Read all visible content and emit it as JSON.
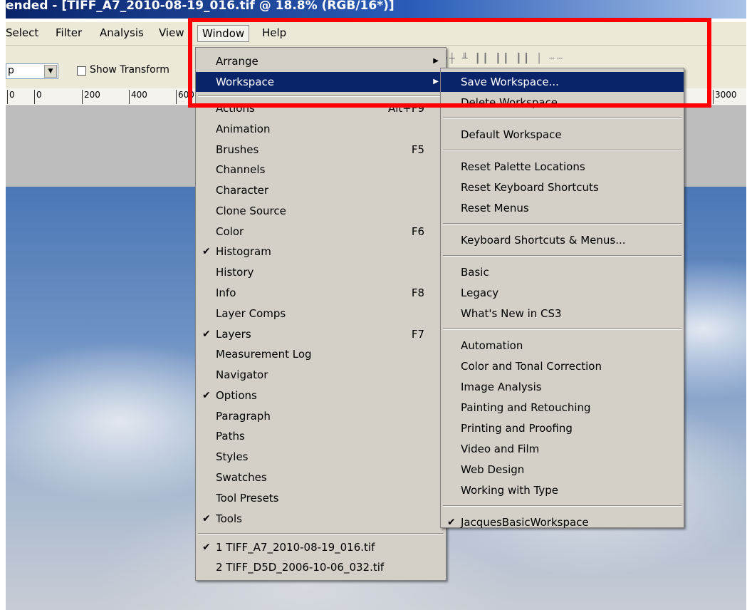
{
  "app": {
    "title": "ended - [TIFF_A7_2010-08-19_016.tif @ 18.8% (RGB/16*)]"
  },
  "menubar": {
    "items": [
      "Select",
      "Filter",
      "Analysis",
      "View",
      "Window",
      "Help"
    ],
    "active": "Window"
  },
  "options_bar": {
    "combo_value": "p",
    "show_transform_label": "Show Transform"
  },
  "ruler": {
    "ticks": [
      "0",
      "0",
      "200",
      "400",
      "600",
      "3000"
    ]
  },
  "window_menu": {
    "top_items": [
      {
        "label": "Arrange",
        "submenu": true
      },
      {
        "label": "Workspace",
        "submenu": true,
        "highlighted": true
      }
    ],
    "panel_items": [
      {
        "label": "Actions",
        "shortcut": "Alt+F9",
        "checked": false
      },
      {
        "label": "Animation",
        "shortcut": "",
        "checked": false
      },
      {
        "label": "Brushes",
        "shortcut": "F5",
        "checked": false
      },
      {
        "label": "Channels",
        "shortcut": "",
        "checked": false
      },
      {
        "label": "Character",
        "shortcut": "",
        "checked": false
      },
      {
        "label": "Clone Source",
        "shortcut": "",
        "checked": false
      },
      {
        "label": "Color",
        "shortcut": "F6",
        "checked": false
      },
      {
        "label": "Histogram",
        "shortcut": "",
        "checked": true
      },
      {
        "label": "History",
        "shortcut": "",
        "checked": false
      },
      {
        "label": "Info",
        "shortcut": "F8",
        "checked": false
      },
      {
        "label": "Layer Comps",
        "shortcut": "",
        "checked": false
      },
      {
        "label": "Layers",
        "shortcut": "F7",
        "checked": true
      },
      {
        "label": "Measurement Log",
        "shortcut": "",
        "checked": false
      },
      {
        "label": "Navigator",
        "shortcut": "",
        "checked": false
      },
      {
        "label": "Options",
        "shortcut": "",
        "checked": true
      },
      {
        "label": "Paragraph",
        "shortcut": "",
        "checked": false
      },
      {
        "label": "Paths",
        "shortcut": "",
        "checked": false
      },
      {
        "label": "Styles",
        "shortcut": "",
        "checked": false
      },
      {
        "label": "Swatches",
        "shortcut": "",
        "checked": false
      },
      {
        "label": "Tool Presets",
        "shortcut": "",
        "checked": false
      },
      {
        "label": "Tools",
        "shortcut": "",
        "checked": true
      }
    ],
    "documents": [
      {
        "label": "1 TIFF_A7_2010-08-19_016.tif",
        "checked": true
      },
      {
        "label": "2 TIFF_D5D_2006-10-06_032.tif",
        "checked": false
      }
    ]
  },
  "workspace_menu": {
    "groups": [
      [
        {
          "label": "Save Workspace...",
          "highlighted": true
        },
        {
          "label": "Delete Workspace..."
        }
      ],
      [
        {
          "label": "Default Workspace"
        }
      ],
      [
        {
          "label": "Reset Palette Locations"
        },
        {
          "label": "Reset Keyboard Shortcuts"
        },
        {
          "label": "Reset Menus"
        }
      ],
      [
        {
          "label": "Keyboard Shortcuts & Menus..."
        }
      ],
      [
        {
          "label": "Basic"
        },
        {
          "label": "Legacy"
        },
        {
          "label": "What's New in CS3"
        }
      ],
      [
        {
          "label": "Automation"
        },
        {
          "label": "Color and Tonal Correction"
        },
        {
          "label": "Image Analysis"
        },
        {
          "label": "Painting and Retouching"
        },
        {
          "label": "Printing and Proofing"
        },
        {
          "label": "Video and Film"
        },
        {
          "label": "Web Design"
        },
        {
          "label": "Working with Type"
        }
      ],
      [
        {
          "label": "JacquesBasicWorkspace",
          "checked": true
        }
      ]
    ]
  },
  "colors": {
    "menu_bg": "#d4d0c8",
    "highlight": "#0a246a",
    "annotation": "#ff0000"
  }
}
